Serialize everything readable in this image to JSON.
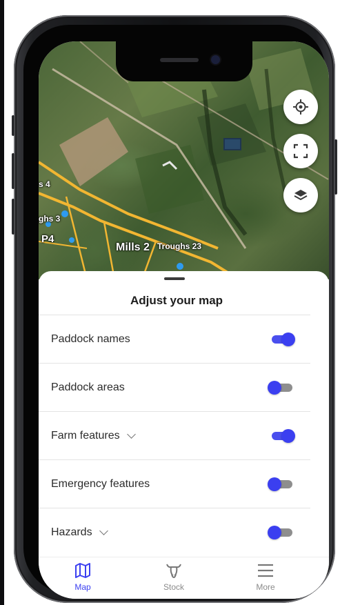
{
  "map": {
    "labels": [
      {
        "id": "s4",
        "text": "s 4"
      },
      {
        "id": "troughs3",
        "text": "ghs 3"
      },
      {
        "id": "p4",
        "text": "P4"
      },
      {
        "id": "mills2",
        "text": "Mills 2"
      },
      {
        "id": "troughs23",
        "text": "Troughs 23"
      }
    ],
    "buttons": {
      "locate_icon": "crosshair-icon",
      "fullscreen_icon": "fullscreen-icon",
      "layers_icon": "layers-icon"
    }
  },
  "sheet": {
    "title": "Adjust your map",
    "rows": [
      {
        "label": "Paddock names",
        "on": true,
        "expandable": false
      },
      {
        "label": "Paddock areas",
        "on": false,
        "expandable": false
      },
      {
        "label": "Farm features",
        "on": true,
        "expandable": true
      },
      {
        "label": "Emergency features",
        "on": false,
        "expandable": false
      },
      {
        "label": "Hazards",
        "on": false,
        "expandable": true
      }
    ]
  },
  "tabs": [
    {
      "label": "Map",
      "icon": "map-icon",
      "active": true
    },
    {
      "label": "Stock",
      "icon": "cow-icon",
      "active": false
    },
    {
      "label": "More",
      "icon": "menu-icon",
      "active": false
    }
  ],
  "colors": {
    "accent": "#3b3ff0",
    "toggle_off_track": "#8e8e8e",
    "paddock_line": "#f2b632",
    "water_point": "#2e9bf0"
  }
}
